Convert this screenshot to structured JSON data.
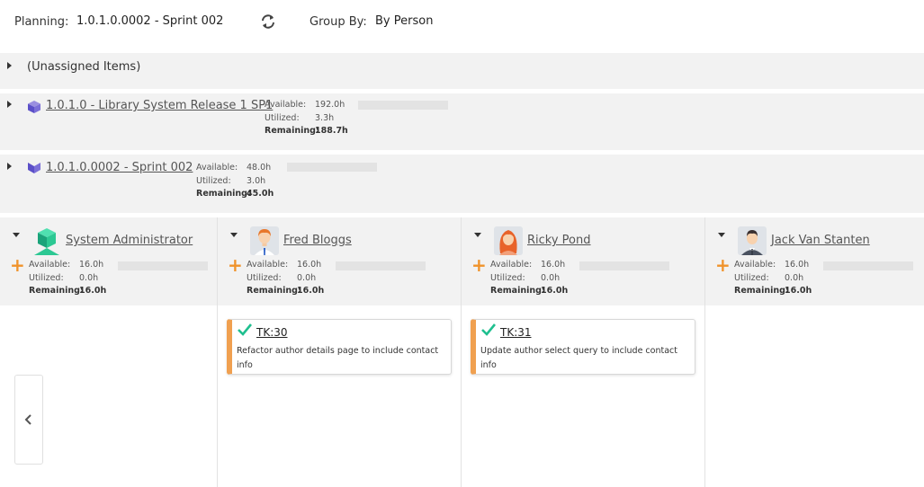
{
  "topbar": {
    "planning_label": "Planning:",
    "planning_value": "1.0.1.0.0002 - Sprint 002",
    "groupby_label": "Group By:",
    "groupby_value": "By Person",
    "refresh_icon": "refresh-icon"
  },
  "unassigned": {
    "label": "(Unassigned Items)"
  },
  "release": {
    "name": "1.0.1.0 - Library System Release 1 SP1",
    "icon": "release-cube-icon",
    "available_label": "Available:",
    "available": "192.0h",
    "utilized_label": "Utilized:",
    "utilized": "3.3h",
    "remaining_label": "Remaining:",
    "remaining": "188.7h",
    "utilized_fraction": 0.017
  },
  "sprint": {
    "name": "1.0.1.0.0002 - Sprint 002",
    "icon": "sprint-icon",
    "available_label": "Available:",
    "available": "48.0h",
    "utilized_label": "Utilized:",
    "utilized": "3.0h",
    "remaining_label": "Remaining:",
    "remaining": "45.0h",
    "utilized_fraction": 0.0625
  },
  "people": [
    {
      "name": "System Administrator",
      "avatar": "admin-cube-avatar",
      "available_label": "Available:",
      "available": "16.0h",
      "utilized_label": "Utilized:",
      "utilized": "0.0h",
      "remaining_label": "Remaining:",
      "remaining": "16.0h"
    },
    {
      "name": "Fred Bloggs",
      "avatar": "man-avatar",
      "available_label": "Available:",
      "available": "16.0h",
      "utilized_label": "Utilized:",
      "utilized": "0.0h",
      "remaining_label": "Remaining:",
      "remaining": "16.0h"
    },
    {
      "name": "Ricky Pond",
      "avatar": "woman-avatar",
      "available_label": "Available:",
      "available": "16.0h",
      "utilized_label": "Utilized:",
      "utilized": "0.0h",
      "remaining_label": "Remaining:",
      "remaining": "16.0h"
    },
    {
      "name": "Jack Van Stanten",
      "avatar": "businessman-avatar",
      "available_label": "Available:",
      "available": "16.0h",
      "utilized_label": "Utilized:",
      "utilized": "0.0h",
      "remaining_label": "Remaining:",
      "remaining": "16.0h"
    }
  ],
  "cards": [
    {
      "id": "TK:30",
      "text": "Refactor author details page to include contact info",
      "icon": "check-icon"
    },
    {
      "id": "TK:31",
      "text": "Update author select query to include contact info",
      "icon": "check-icon"
    }
  ],
  "nav": {
    "prev_icon": "chevron-left-icon"
  },
  "colors": {
    "accent": "#f0932b",
    "card_border": "#f0a050",
    "check": "#1fbf8f",
    "row_bg": "#f2f2f2"
  }
}
